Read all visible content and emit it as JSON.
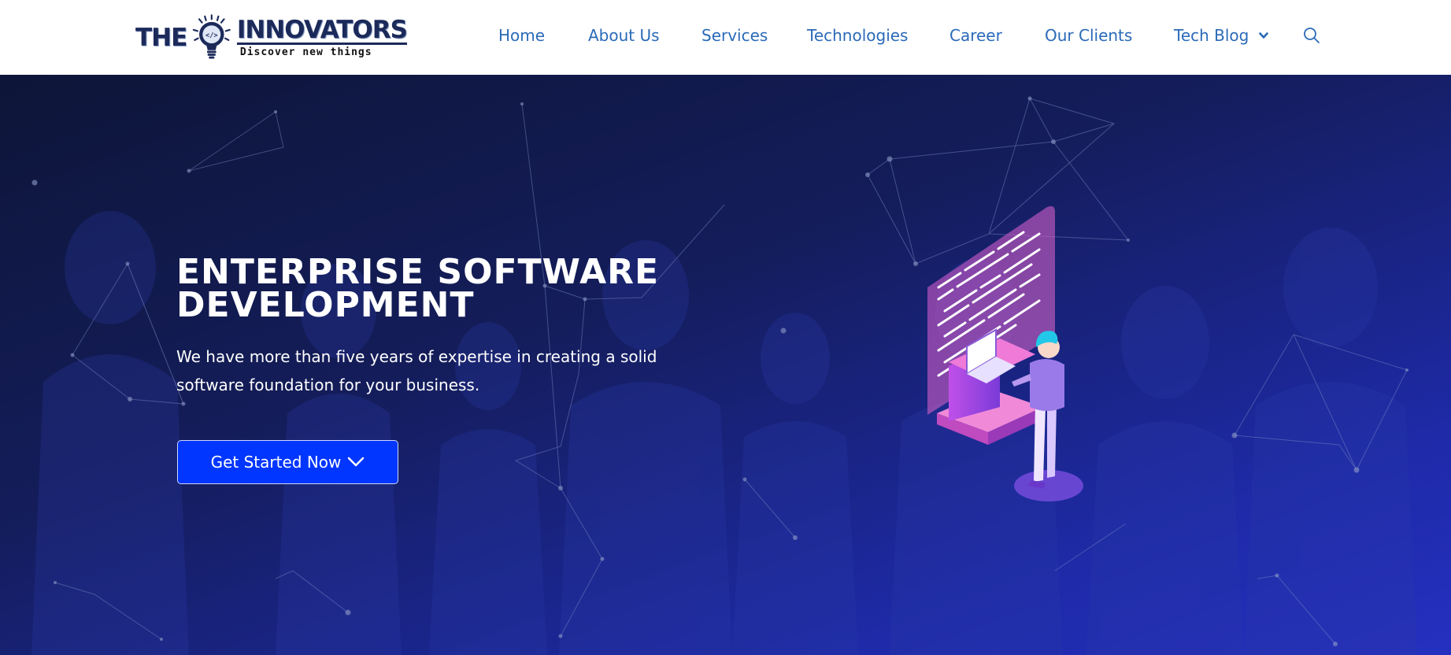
{
  "brand": {
    "name_left": "THE",
    "name_right": "INNOVATORS",
    "tagline": "Discover new things",
    "logo_icon": "lightbulb-code-icon",
    "color": "#1c2a5a"
  },
  "nav": {
    "items": [
      {
        "label": "Home"
      },
      {
        "label": "About Us"
      },
      {
        "label": "Services"
      },
      {
        "label": "Technologies"
      },
      {
        "label": "Career"
      },
      {
        "label": "Our Clients"
      },
      {
        "label": "Tech Blog",
        "icon": "chevron-down-icon"
      }
    ],
    "search_icon": "search-icon",
    "link_color": "#2a6ab8"
  },
  "hero": {
    "title_line1": "ENTERPRISE SOFTWARE",
    "title_line2": "DEVELOPMENT",
    "subtitle": "We have more than five years of expertise in creating a solid software foundation for your business.",
    "cta_label": "Get Started Now",
    "cta_icon": "chevron-down-icon",
    "cta_color": "#0036ff",
    "illustration": "developer-at-screen-illustration"
  }
}
